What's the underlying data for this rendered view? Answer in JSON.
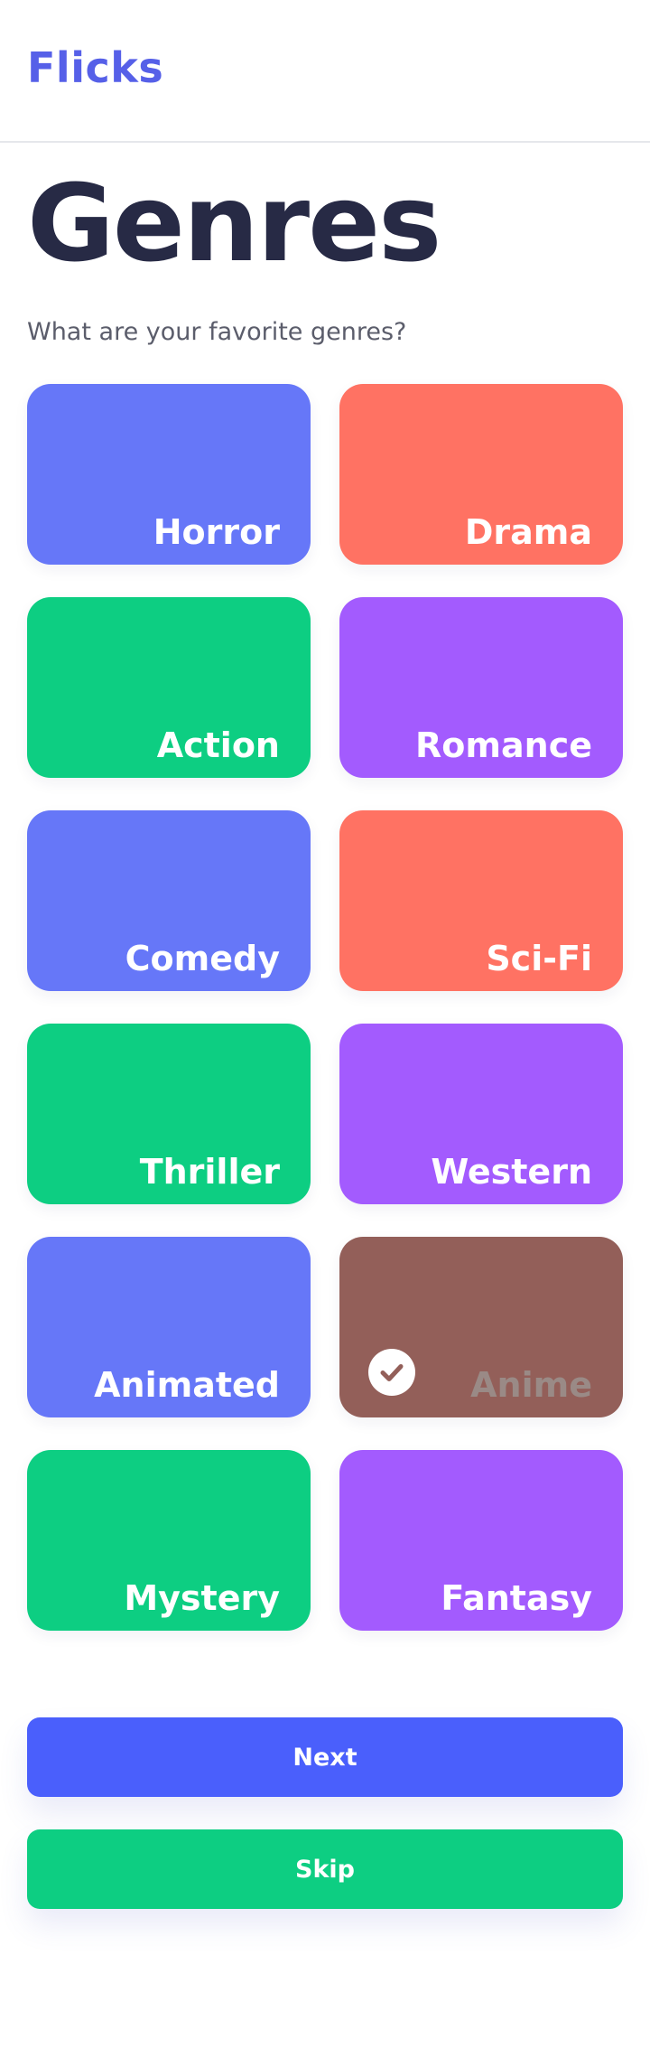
{
  "app": {
    "brand": "Flicks"
  },
  "page": {
    "title": "Genres",
    "subtitle": "What are your favorite genres?"
  },
  "genres": [
    {
      "label": "Horror",
      "color": "#6677f8",
      "selected": false
    },
    {
      "label": "Drama",
      "color": "#ff7263",
      "selected": false
    },
    {
      "label": "Action",
      "color": "#0dce82",
      "selected": false
    },
    {
      "label": "Romance",
      "color": "#a35bfe",
      "selected": false
    },
    {
      "label": "Comedy",
      "color": "#6677f8",
      "selected": false
    },
    {
      "label": "Sci-Fi",
      "color": "#ff7263",
      "selected": false
    },
    {
      "label": "Thriller",
      "color": "#0dce82",
      "selected": false
    },
    {
      "label": "Western",
      "color": "#a35bfe",
      "selected": false
    },
    {
      "label": "Animated",
      "color": "#6677f8",
      "selected": false
    },
    {
      "label": "Anime",
      "color": "#935f59",
      "selected": true,
      "icon": "check-circle-icon"
    },
    {
      "label": "Mystery",
      "color": "#0dce82",
      "selected": false
    },
    {
      "label": "Fantasy",
      "color": "#a35bfe",
      "selected": false
    }
  ],
  "actions": {
    "next_label": "Next",
    "next_color": "#4a5ffc",
    "skip_label": "Skip",
    "skip_color": "#0dce82"
  },
  "colors": {
    "brand": "#5660e8",
    "title": "#272a45"
  }
}
